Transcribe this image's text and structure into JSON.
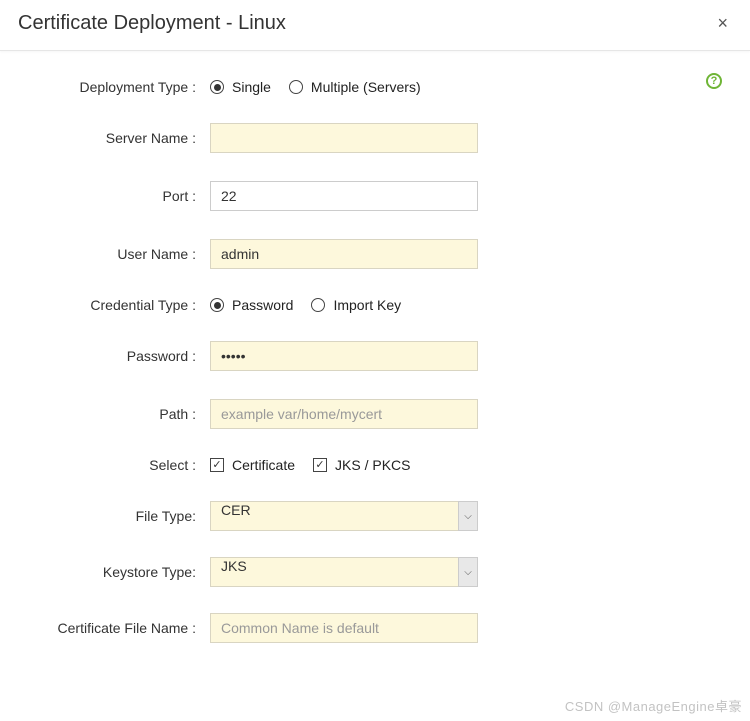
{
  "header": {
    "title": "Certificate Deployment - Linux"
  },
  "labels": {
    "deployment_type": "Deployment Type :",
    "server_name": "Server Name :",
    "port": "Port :",
    "user_name": "User Name :",
    "credential_type": "Credential Type :",
    "password": "Password :",
    "path": "Path :",
    "select": "Select :",
    "file_type": "File Type:",
    "keystore_type": "Keystore Type:",
    "cert_file_name": "Certificate File Name :"
  },
  "deployment_type": {
    "options": {
      "single": "Single",
      "multiple": "Multiple (Servers)"
    },
    "selected": "single"
  },
  "server_name": {
    "value": ""
  },
  "port": {
    "value": "22"
  },
  "user_name": {
    "value": "admin"
  },
  "credential_type": {
    "options": {
      "password": "Password",
      "import_key": "Import Key"
    },
    "selected": "password"
  },
  "password": {
    "value": "•••••"
  },
  "path": {
    "placeholder": "example var/home/mycert",
    "value": ""
  },
  "select": {
    "certificate": {
      "label": "Certificate",
      "checked": true
    },
    "jks_pkcs": {
      "label": "JKS / PKCS",
      "checked": true
    }
  },
  "file_type": {
    "value": "CER"
  },
  "keystore_type": {
    "value": "JKS"
  },
  "cert_file_name": {
    "placeholder": "Common Name is default",
    "value": ""
  },
  "watermark": "CSDN @ManageEngine卓豪",
  "icons": {
    "help": "?",
    "close": "×",
    "check": "✓",
    "chevron": "⌵"
  }
}
